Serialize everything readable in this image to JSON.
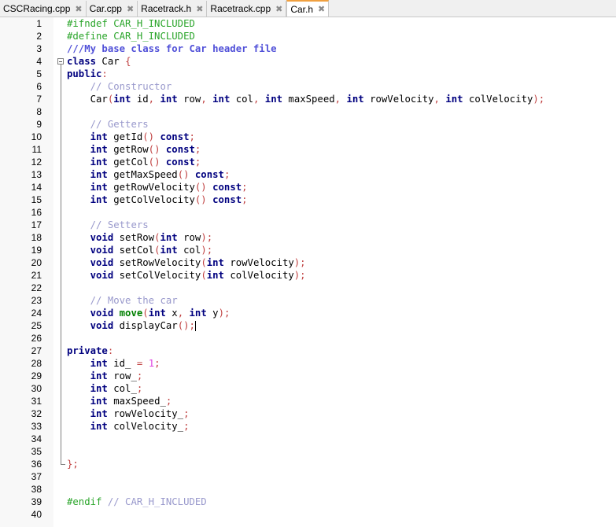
{
  "tabs": [
    {
      "label": "CSCRacing.cpp",
      "active": false
    },
    {
      "label": "Car.cpp",
      "active": false
    },
    {
      "label": "Racetrack.h",
      "active": false
    },
    {
      "label": "Racetrack.cpp",
      "active": false
    },
    {
      "label": "Car.h",
      "active": true
    }
  ],
  "close_glyph": "✖",
  "colors": {
    "preprocessor": "#2aa52a",
    "comment": "#9999cc",
    "keyword": "#00007f",
    "operator": "#c04040",
    "number": "#e040e0"
  },
  "lines": [
    [
      [
        "pp",
        "#ifndef CAR_H_INCLUDED"
      ]
    ],
    [
      [
        "pp",
        "#define CAR_H_INCLUDED"
      ]
    ],
    [
      [
        "doc",
        "///My base class for Car header file"
      ]
    ],
    [
      [
        "kw",
        "class"
      ],
      [
        "t",
        " Car "
      ],
      [
        "op",
        "{"
      ]
    ],
    [
      [
        "kw",
        "public"
      ],
      [
        "op",
        ":"
      ]
    ],
    [
      [
        "t",
        "    "
      ],
      [
        "cm",
        "// Constructor"
      ]
    ],
    [
      [
        "t",
        "    Car"
      ],
      [
        "op",
        "("
      ],
      [
        "kw",
        "int"
      ],
      [
        "t",
        " id"
      ],
      [
        "op",
        ","
      ],
      [
        "t",
        " "
      ],
      [
        "kw",
        "int"
      ],
      [
        "t",
        " row"
      ],
      [
        "op",
        ","
      ],
      [
        "t",
        " "
      ],
      [
        "kw",
        "int"
      ],
      [
        "t",
        " col"
      ],
      [
        "op",
        ","
      ],
      [
        "t",
        " "
      ],
      [
        "kw",
        "int"
      ],
      [
        "t",
        " maxSpeed"
      ],
      [
        "op",
        ","
      ],
      [
        "t",
        " "
      ],
      [
        "kw",
        "int"
      ],
      [
        "t",
        " rowVelocity"
      ],
      [
        "op",
        ","
      ],
      [
        "t",
        " "
      ],
      [
        "kw",
        "int"
      ],
      [
        "t",
        " colVelocity"
      ],
      [
        "op",
        ");"
      ]
    ],
    [],
    [
      [
        "t",
        "    "
      ],
      [
        "cm",
        "// Getters"
      ]
    ],
    [
      [
        "t",
        "    "
      ],
      [
        "kw",
        "int"
      ],
      [
        "t",
        " getId"
      ],
      [
        "op",
        "()"
      ],
      [
        "t",
        " "
      ],
      [
        "kw",
        "const"
      ],
      [
        "op",
        ";"
      ]
    ],
    [
      [
        "t",
        "    "
      ],
      [
        "kw",
        "int"
      ],
      [
        "t",
        " getRow"
      ],
      [
        "op",
        "()"
      ],
      [
        "t",
        " "
      ],
      [
        "kw",
        "const"
      ],
      [
        "op",
        ";"
      ]
    ],
    [
      [
        "t",
        "    "
      ],
      [
        "kw",
        "int"
      ],
      [
        "t",
        " getCol"
      ],
      [
        "op",
        "()"
      ],
      [
        "t",
        " "
      ],
      [
        "kw",
        "const"
      ],
      [
        "op",
        ";"
      ]
    ],
    [
      [
        "t",
        "    "
      ],
      [
        "kw",
        "int"
      ],
      [
        "t",
        " getMaxSpeed"
      ],
      [
        "op",
        "()"
      ],
      [
        "t",
        " "
      ],
      [
        "kw",
        "const"
      ],
      [
        "op",
        ";"
      ]
    ],
    [
      [
        "t",
        "    "
      ],
      [
        "kw",
        "int"
      ],
      [
        "t",
        " getRowVelocity"
      ],
      [
        "op",
        "()"
      ],
      [
        "t",
        " "
      ],
      [
        "kw",
        "const"
      ],
      [
        "op",
        ";"
      ]
    ],
    [
      [
        "t",
        "    "
      ],
      [
        "kw",
        "int"
      ],
      [
        "t",
        " getColVelocity"
      ],
      [
        "op",
        "()"
      ],
      [
        "t",
        " "
      ],
      [
        "kw",
        "const"
      ],
      [
        "op",
        ";"
      ]
    ],
    [],
    [
      [
        "t",
        "    "
      ],
      [
        "cm",
        "// Setters"
      ]
    ],
    [
      [
        "t",
        "    "
      ],
      [
        "kw",
        "void"
      ],
      [
        "t",
        " setRow"
      ],
      [
        "op",
        "("
      ],
      [
        "kw",
        "int"
      ],
      [
        "t",
        " row"
      ],
      [
        "op",
        ");"
      ]
    ],
    [
      [
        "t",
        "    "
      ],
      [
        "kw",
        "void"
      ],
      [
        "t",
        " setCol"
      ],
      [
        "op",
        "("
      ],
      [
        "kw",
        "int"
      ],
      [
        "t",
        " col"
      ],
      [
        "op",
        ");"
      ]
    ],
    [
      [
        "t",
        "    "
      ],
      [
        "kw",
        "void"
      ],
      [
        "t",
        " setRowVelocity"
      ],
      [
        "op",
        "("
      ],
      [
        "kw",
        "int"
      ],
      [
        "t",
        " rowVelocity"
      ],
      [
        "op",
        ");"
      ]
    ],
    [
      [
        "t",
        "    "
      ],
      [
        "kw",
        "void"
      ],
      [
        "t",
        " setColVelocity"
      ],
      [
        "op",
        "("
      ],
      [
        "kw",
        "int"
      ],
      [
        "t",
        " colVelocity"
      ],
      [
        "op",
        ");"
      ]
    ],
    [],
    [
      [
        "t",
        "    "
      ],
      [
        "cm",
        "// Move the car"
      ]
    ],
    [
      [
        "t",
        "    "
      ],
      [
        "kw",
        "void"
      ],
      [
        "t",
        " "
      ],
      [
        "fn",
        "move"
      ],
      [
        "op",
        "("
      ],
      [
        "kw",
        "int"
      ],
      [
        "t",
        " x"
      ],
      [
        "op",
        ","
      ],
      [
        "t",
        " "
      ],
      [
        "kw",
        "int"
      ],
      [
        "t",
        " y"
      ],
      [
        "op",
        ");"
      ]
    ],
    [
      [
        "t",
        "    "
      ],
      [
        "kw",
        "void"
      ],
      [
        "t",
        " displayCar"
      ],
      [
        "op",
        "();"
      ],
      [
        "caret",
        ""
      ]
    ],
    [],
    [
      [
        "kw",
        "private"
      ],
      [
        "op",
        ":"
      ]
    ],
    [
      [
        "t",
        "    "
      ],
      [
        "kw",
        "int"
      ],
      [
        "t",
        " id_ "
      ],
      [
        "op",
        "="
      ],
      [
        "t",
        " "
      ],
      [
        "num",
        "1"
      ],
      [
        "op",
        ";"
      ]
    ],
    [
      [
        "t",
        "    "
      ],
      [
        "kw",
        "int"
      ],
      [
        "t",
        " row_"
      ],
      [
        "op",
        ";"
      ]
    ],
    [
      [
        "t",
        "    "
      ],
      [
        "kw",
        "int"
      ],
      [
        "t",
        " col_"
      ],
      [
        "op",
        ";"
      ]
    ],
    [
      [
        "t",
        "    "
      ],
      [
        "kw",
        "int"
      ],
      [
        "t",
        " maxSpeed_"
      ],
      [
        "op",
        ";"
      ]
    ],
    [
      [
        "t",
        "    "
      ],
      [
        "kw",
        "int"
      ],
      [
        "t",
        " rowVelocity_"
      ],
      [
        "op",
        ";"
      ]
    ],
    [
      [
        "t",
        "    "
      ],
      [
        "kw",
        "int"
      ],
      [
        "t",
        " colVelocity_"
      ],
      [
        "op",
        ";"
      ]
    ],
    [],
    [],
    [
      [
        "op",
        "};"
      ]
    ],
    [],
    [],
    [
      [
        "pp",
        "#endif"
      ],
      [
        "t",
        " "
      ],
      [
        "cm",
        "// CAR_H_INCLUDED"
      ]
    ],
    []
  ]
}
